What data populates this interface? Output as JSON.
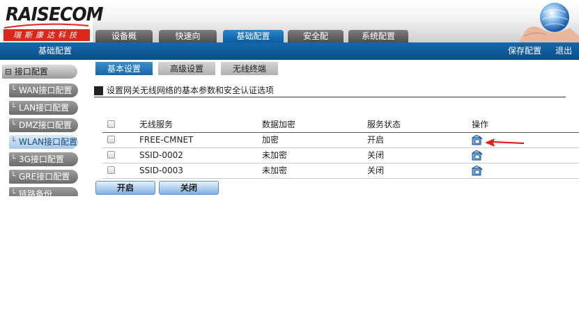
{
  "brand": {
    "name": "RAISECOM",
    "tagline": "瑞斯康达科技"
  },
  "nav_tabs": [
    {
      "label": "设备概览",
      "active": false
    },
    {
      "label": "快速向导",
      "active": false
    },
    {
      "label": "基础配置",
      "active": true
    },
    {
      "label": "安全配置",
      "active": false
    },
    {
      "label": "系统配置",
      "active": false
    }
  ],
  "bluebar": {
    "breadcrumb": "基础配置",
    "save": "保存配置",
    "logout": "退出"
  },
  "sidebar": {
    "group": "接口配置",
    "group_glyph": "⊟",
    "items": [
      {
        "label": "WAN接口配置",
        "active": false
      },
      {
        "label": "LAN接口配置",
        "active": false
      },
      {
        "label": "DMZ接口配置",
        "active": false
      },
      {
        "label": "WLAN接口配置",
        "active": true
      },
      {
        "label": "3G接口配置",
        "active": false
      },
      {
        "label": "GRE接口配置",
        "active": false
      },
      {
        "label": "链路备份",
        "active": false
      }
    ]
  },
  "sub_tabs": [
    {
      "label": "基本设置",
      "active": true
    },
    {
      "label": "高级设置",
      "active": false
    },
    {
      "label": "无线终端",
      "active": false
    }
  ],
  "section_title": "设置网关无线网络的基本参数和安全认证选项",
  "table": {
    "headers": [
      "无线服务",
      "数据加密",
      "服务状态",
      "操作"
    ],
    "rows": [
      {
        "ssid": "FREE-CMNET",
        "encryption": "加密",
        "status": "开启"
      },
      {
        "ssid": "SSID-0002",
        "encryption": "未加密",
        "status": "关闭"
      },
      {
        "ssid": "SSID-0003",
        "encryption": "未加密",
        "status": "关闭"
      }
    ]
  },
  "buttons": {
    "enable": "开启",
    "disable": "关闭"
  },
  "colors": {
    "nav_blue": "#1467ad",
    "annotation_arrow": "#e0201b",
    "logo_red": "#e2251b"
  }
}
